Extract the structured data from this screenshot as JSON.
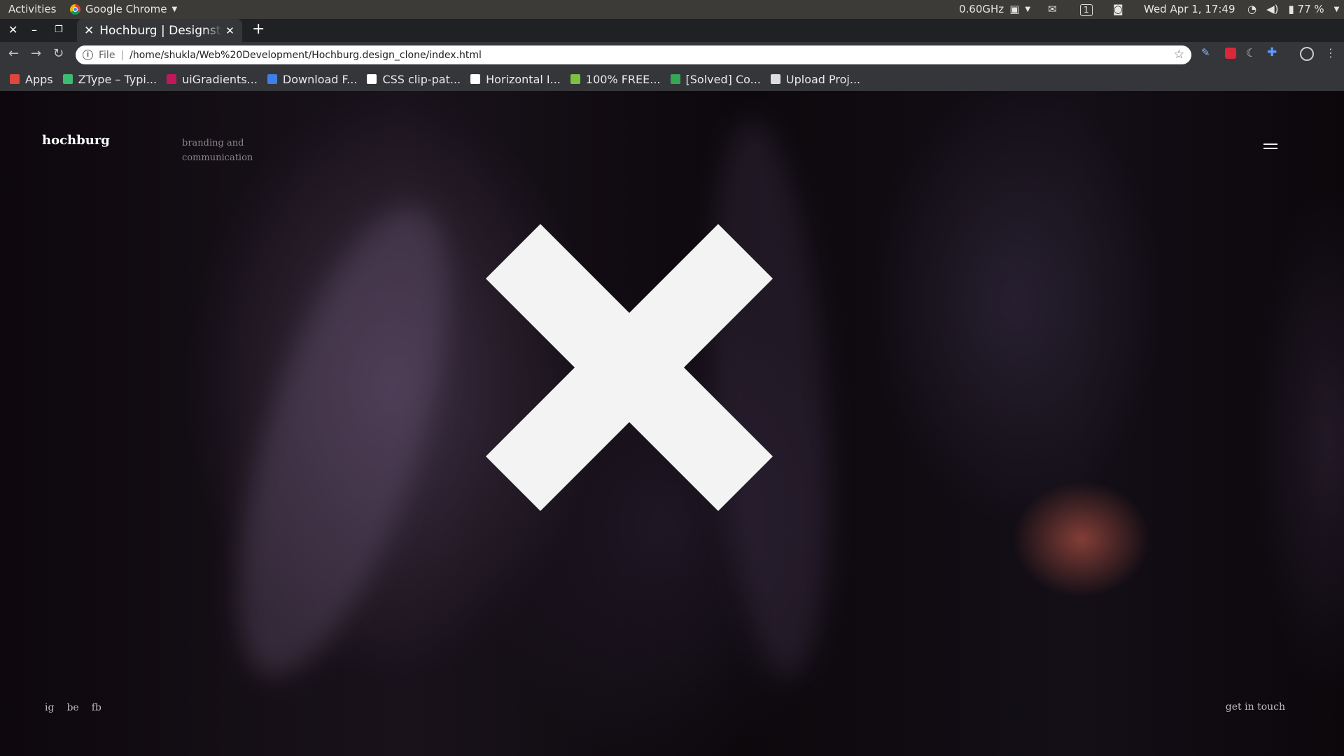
{
  "os": {
    "activities": "Activities",
    "app_name": "Google Chrome",
    "cpu_freq": "0.60GHz",
    "workspace": "1",
    "clock": "Wed Apr  1, 17:49",
    "battery": "77 %"
  },
  "browser": {
    "tab_title": "Hochburg | Designstudio",
    "url_scheme": "File",
    "url": "/home/shukla/Web%20Development/Hochburg.design_clone/index.html",
    "bookmarks": [
      {
        "label": "Apps",
        "icon": "apps-grid-icon",
        "color": "#e0463c"
      },
      {
        "label": "ZType – Typi...",
        "icon": "ztype-icon",
        "color": "#3dbb73"
      },
      {
        "label": "uiGradients...",
        "icon": "uigradients-icon",
        "color": "#c2185b"
      },
      {
        "label": "Download F...",
        "icon": "download-icon",
        "color": "#3f7ee8"
      },
      {
        "label": "CSS clip-pat...",
        "icon": "codepen-icon",
        "color": "#ffffff"
      },
      {
        "label": "Horizontal I...",
        "icon": "codepen-icon",
        "color": "#ffffff"
      },
      {
        "label": "100% FREE...",
        "icon": "leaf-icon",
        "color": "#7cc242"
      },
      {
        "label": "[Solved] Co...",
        "icon": "solved-icon",
        "color": "#34a853"
      },
      {
        "label": "Upload Proj...",
        "icon": "tm-icon",
        "color": "#dddddd"
      }
    ]
  },
  "site": {
    "logo": "hochburg",
    "tagline": "branding and communication",
    "social": [
      "ig",
      "be",
      "fb"
    ],
    "contact": "get in touch",
    "x_color": "#f3f3f3"
  }
}
